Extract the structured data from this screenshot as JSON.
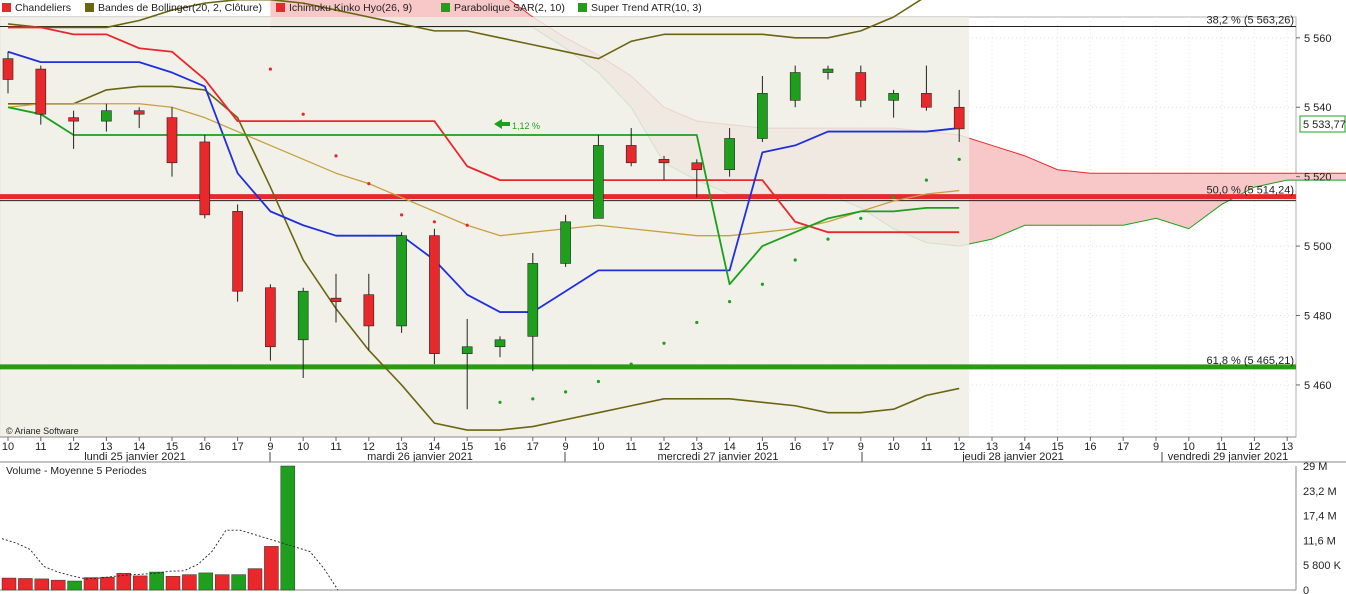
{
  "legend": [
    {
      "name": "Chandeliers",
      "color": "#e8282a"
    },
    {
      "name": "Bandes de Bollinger(20, 2, Clôture)",
      "color": "#6b6512"
    },
    {
      "name": "Ichimoku Kinko Hyo(26, 9)",
      "color": "#e8282a"
    },
    {
      "name": "Parabolique SAR(2, 10)",
      "color": "#1ea01e"
    },
    {
      "name": "Super Trend ATR(10, 3)",
      "color": "#1ea01e"
    }
  ],
  "copyright": "© Ariane Software",
  "volume_title": "Volume  - Moyenne 5 Periodes",
  "last_price_label": "5 533,77",
  "change_label": "1,12 %",
  "fibo": [
    {
      "label": "38,2 % (5 563,26)",
      "value": 5563.26,
      "color": "#222222"
    },
    {
      "label": "50,0 % (5 514,24)",
      "value": 5514.24,
      "color": "#e8282a"
    },
    {
      "label": "61,8 % (5 465,21)",
      "value": 5465.21,
      "color": "#2a9a10"
    }
  ],
  "colors": {
    "up": "#1ea01e",
    "down": "#e8282a",
    "cloud_bear": "#f8c8c8",
    "cloud_shade": "#efeee6",
    "bollinger": "#6b6512",
    "supertrend": "#1aa01a",
    "tenkan": "#1f2fe0",
    "kijun": "#e8282a",
    "ma": "#c8a040"
  },
  "chart_data": {
    "type": "candlestick",
    "x_ticks": [
      "10",
      "11",
      "12",
      "13",
      "14",
      "15",
      "16",
      "17",
      "9",
      "10",
      "11",
      "12",
      "13",
      "14",
      "15",
      "16",
      "17",
      "9",
      "10",
      "11",
      "12",
      "13",
      "14",
      "15",
      "16",
      "17",
      "9",
      "10",
      "11",
      "12",
      "13",
      "14",
      "15",
      "16",
      "17",
      "9",
      "10",
      "11",
      "12",
      "13"
    ],
    "day_labels": [
      "lundi 25 janvier 2021",
      "mardi 26 janvier 2021",
      "mercredi 27 janvier 2021",
      "jeudi 28 janvier 2021",
      "vendredi 29 janvier 2021"
    ],
    "y_ticks": [
      "5 560",
      "5 540",
      "5 520",
      "5 500",
      "5 480",
      "5 460"
    ],
    "y_tick_values": [
      5560,
      5540,
      5520,
      5500,
      5480,
      5460
    ],
    "ylim": [
      5445,
      5566
    ],
    "candles": [
      {
        "o": 5554,
        "h": 5556,
        "l": 5544,
        "c": 5548
      },
      {
        "o": 5551,
        "h": 5552,
        "l": 5535,
        "c": 5538
      },
      {
        "o": 5537,
        "h": 5539,
        "l": 5528,
        "c": 5536
      },
      {
        "o": 5536,
        "h": 5541,
        "l": 5533,
        "c": 5539
      },
      {
        "o": 5539,
        "h": 5540,
        "l": 5534,
        "c": 5538
      },
      {
        "o": 5537,
        "h": 5540,
        "l": 5520,
        "c": 5524
      },
      {
        "o": 5530,
        "h": 5532,
        "l": 5508,
        "c": 5509
      },
      {
        "o": 5510,
        "h": 5512,
        "l": 5484,
        "c": 5487
      },
      {
        "o": 5488,
        "h": 5489,
        "l": 5467,
        "c": 5471
      },
      {
        "o": 5473,
        "h": 5488,
        "l": 5462,
        "c": 5487
      },
      {
        "o": 5485,
        "h": 5492,
        "l": 5478,
        "c": 5484
      },
      {
        "o": 5486,
        "h": 5492,
        "l": 5470,
        "c": 5477
      },
      {
        "o": 5477,
        "h": 5504,
        "l": 5475,
        "c": 5503
      },
      {
        "o": 5503,
        "h": 5505,
        "l": 5466,
        "c": 5469
      },
      {
        "o": 5469,
        "h": 5479,
        "l": 5453,
        "c": 5471
      },
      {
        "o": 5471,
        "h": 5474,
        "l": 5468,
        "c": 5473
      },
      {
        "o": 5474,
        "h": 5498,
        "l": 5464,
        "c": 5495
      },
      {
        "o": 5495,
        "h": 5509,
        "l": 5494,
        "c": 5507
      },
      {
        "o": 5508,
        "h": 5532,
        "l": 5508,
        "c": 5529
      },
      {
        "o": 5529,
        "h": 5534,
        "l": 5523,
        "c": 5524
      },
      {
        "o": 5525,
        "h": 5526,
        "l": 5519,
        "c": 5524
      },
      {
        "o": 5524,
        "h": 5525,
        "l": 5514,
        "c": 5522
      },
      {
        "o": 5522,
        "h": 5534,
        "l": 5520,
        "c": 5531
      },
      {
        "o": 5531,
        "h": 5549,
        "l": 5530,
        "c": 5544
      },
      {
        "o": 5542,
        "h": 5552,
        "l": 5540,
        "c": 5550
      },
      {
        "o": 5550,
        "h": 5552,
        "l": 5548,
        "c": 5551
      },
      {
        "o": 5550,
        "h": 5552,
        "l": 5540,
        "c": 5542
      },
      {
        "o": 5542,
        "h": 5545,
        "l": 5537,
        "c": 5544
      },
      {
        "o": 5544,
        "h": 5552,
        "l": 5539,
        "c": 5540
      },
      {
        "o": 5540,
        "h": 5545,
        "l": 5530,
        "c": 5533.77
      }
    ],
    "bollinger_upper": [
      5564,
      5563,
      5563,
      5563,
      5565,
      5568,
      5570,
      5571,
      5571,
      5570,
      5568,
      5566,
      5564,
      5562,
      5562,
      5560,
      5558,
      5556,
      5554,
      5559,
      5561,
      5561,
      5561,
      5561,
      5560,
      5560,
      5562,
      5566,
      5572,
      5572
    ],
    "bollinger_lower": [
      5541,
      5541,
      5541,
      5545,
      5546,
      5546,
      5545,
      5537,
      5517,
      5496,
      5482,
      5470,
      5460,
      5449,
      5447,
      5447,
      5448,
      5450,
      5452,
      5454,
      5456,
      5456,
      5456,
      5455,
      5454,
      5452,
      5452,
      5453,
      5457,
      5459
    ],
    "bollinger_mid": [
      5540,
      5541,
      5541,
      5541,
      5541,
      5540,
      5537,
      5533,
      5529,
      5525,
      5521,
      5518,
      5514,
      5510,
      5506,
      5503,
      5504,
      5505,
      5506,
      5505,
      5504,
      5503,
      5503,
      5504,
      5505,
      5507,
      5510,
      5513,
      5515,
      5516
    ],
    "tenkan": [
      5556,
      5553,
      5553,
      5553,
      5553,
      5550,
      5546,
      5521,
      5510,
      5506,
      5503,
      5503,
      5503,
      5496,
      5486,
      5481,
      5481,
      5487,
      5493,
      5493,
      5493,
      5493,
      5493,
      5527,
      5529,
      5533,
      5533,
      5533,
      5533,
      5534
    ],
    "kijun": [
      5563,
      5563,
      5561,
      5561,
      5557,
      5556,
      5548,
      5536,
      5536,
      5536,
      5536,
      5536,
      5536,
      5536,
      5523,
      5519,
      5519,
      5519,
      5519,
      5519,
      5519,
      5519,
      5519,
      5519,
      5507,
      5504,
      5504,
      5504,
      5504,
      5504
    ],
    "supertrend": [
      5540,
      5538,
      5532,
      5532,
      5532,
      5532,
      5532,
      5532,
      5532,
      5532,
      5532,
      5532,
      5532,
      5532,
      5532,
      5532,
      5532,
      5532,
      5532,
      5532,
      5532,
      5532,
      5489,
      5500,
      5504,
      5508,
      5510,
      5510,
      5511,
      5511
    ],
    "sar": [
      null,
      null,
      null,
      null,
      null,
      null,
      null,
      null,
      5551,
      5538,
      5526,
      5518,
      5509,
      5507,
      5506,
      5455,
      5456,
      5458,
      5461,
      5466,
      5472,
      5478,
      5484,
      5489,
      5496,
      5502,
      5508,
      5514,
      5519,
      5525
    ],
    "cloud_a": [
      5573,
      5573,
      5573,
      5573,
      5573,
      5573,
      5573,
      5573,
      5566,
      5560,
      5555,
      5549,
      5540,
      5536,
      5535,
      5534,
      5534,
      5534,
      5534,
      5534,
      5533,
      5532,
      5529,
      5526,
      5522,
      5521,
      5521
    ],
    "cloud_b": [
      5563,
      5563,
      5563,
      5563,
      5563,
      5563,
      5563,
      5563,
      5563,
      5557,
      5550,
      5540,
      5524,
      5519,
      5515,
      5515,
      5515,
      5515,
      5511,
      5505,
      5501,
      5500,
      5502,
      5506,
      5506,
      5506,
      5506,
      5508,
      5505,
      5512,
      5517,
      5519,
      5519,
      5519
    ],
    "volume": {
      "values": [
        2.8,
        2.7,
        2.6,
        2.3,
        2.1,
        2.9,
        3.0,
        3.9,
        3.3,
        4.2,
        3.2,
        3.6,
        4.0,
        3.6,
        3.6,
        5.0,
        10.2,
        29.0
      ],
      "ma": [
        12.0,
        11.0,
        9.5,
        5.5,
        4.2,
        3.3,
        2.6,
        2.8,
        3.2,
        3.5,
        3.7,
        3.9,
        4.4,
        4.5,
        6.0,
        9.0,
        14.0,
        14.0,
        13.0,
        12.0,
        11.0,
        10.0,
        9.0,
        5.0,
        0
      ],
      "y_ticks": [
        "29 M",
        "23,2 M",
        "17,4 M",
        "11,6 M",
        "5 800 K",
        "0"
      ],
      "max": 29
    }
  }
}
